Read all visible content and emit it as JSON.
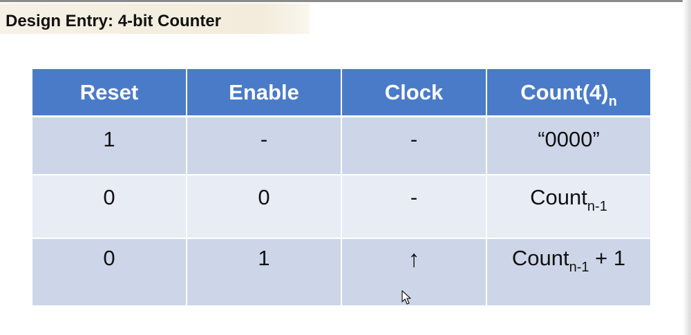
{
  "title": "Design Entry: 4-bit Counter",
  "table": {
    "headers": [
      {
        "main": "Reset",
        "sub": ""
      },
      {
        "main": "Enable",
        "sub": ""
      },
      {
        "main": "Clock",
        "sub": ""
      },
      {
        "main": "Count(4)",
        "sub": "n"
      }
    ],
    "rows": [
      {
        "reset": "1",
        "enable": "-",
        "clock": "-",
        "count": {
          "main": "“0000”",
          "sub": "",
          "suffix": ""
        }
      },
      {
        "reset": "0",
        "enable": "0",
        "clock": "-",
        "count": {
          "main": "Count",
          "sub": "n-1",
          "suffix": ""
        }
      },
      {
        "reset": "0",
        "enable": "1",
        "clock": "↑",
        "count": {
          "main": "Count",
          "sub": "n-1",
          "suffix": " + 1"
        }
      }
    ]
  },
  "icons": {
    "cursor": "mouse-pointer-icon"
  },
  "colors": {
    "header": "#4a7bc8",
    "row_dark": "#cdd6e8",
    "row_light": "#e8ecf5",
    "title_band": "#f3ecdc"
  }
}
